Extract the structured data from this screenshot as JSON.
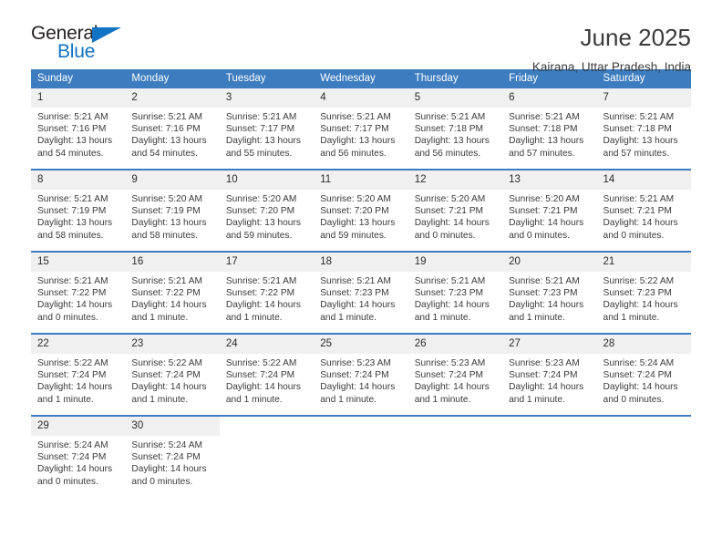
{
  "brand": {
    "name_part1": "General",
    "name_part2": "Blue",
    "accent_color": "#1272c4",
    "triangle_icon": "triangle-icon"
  },
  "header": {
    "title": "June 2025",
    "subtitle": "Kairana, Uttar Pradesh, India"
  },
  "colors": {
    "header_row": "#3c7cbf",
    "day_number_bg": "#f0f0f0",
    "text": "#3a3a3a"
  },
  "calendar": {
    "weekday_headers": [
      "Sunday",
      "Monday",
      "Tuesday",
      "Wednesday",
      "Thursday",
      "Friday",
      "Saturday"
    ],
    "weeks": [
      [
        {
          "day": "1",
          "sunrise": "Sunrise: 5:21 AM",
          "sunset": "Sunset: 7:16 PM",
          "daylight_line1": "Daylight: 13 hours",
          "daylight_line2": "and 54 minutes."
        },
        {
          "day": "2",
          "sunrise": "Sunrise: 5:21 AM",
          "sunset": "Sunset: 7:16 PM",
          "daylight_line1": "Daylight: 13 hours",
          "daylight_line2": "and 54 minutes."
        },
        {
          "day": "3",
          "sunrise": "Sunrise: 5:21 AM",
          "sunset": "Sunset: 7:17 PM",
          "daylight_line1": "Daylight: 13 hours",
          "daylight_line2": "and 55 minutes."
        },
        {
          "day": "4",
          "sunrise": "Sunrise: 5:21 AM",
          "sunset": "Sunset: 7:17 PM",
          "daylight_line1": "Daylight: 13 hours",
          "daylight_line2": "and 56 minutes."
        },
        {
          "day": "5",
          "sunrise": "Sunrise: 5:21 AM",
          "sunset": "Sunset: 7:18 PM",
          "daylight_line1": "Daylight: 13 hours",
          "daylight_line2": "and 56 minutes."
        },
        {
          "day": "6",
          "sunrise": "Sunrise: 5:21 AM",
          "sunset": "Sunset: 7:18 PM",
          "daylight_line1": "Daylight: 13 hours",
          "daylight_line2": "and 57 minutes."
        },
        {
          "day": "7",
          "sunrise": "Sunrise: 5:21 AM",
          "sunset": "Sunset: 7:18 PM",
          "daylight_line1": "Daylight: 13 hours",
          "daylight_line2": "and 57 minutes."
        }
      ],
      [
        {
          "day": "8",
          "sunrise": "Sunrise: 5:21 AM",
          "sunset": "Sunset: 7:19 PM",
          "daylight_line1": "Daylight: 13 hours",
          "daylight_line2": "and 58 minutes."
        },
        {
          "day": "9",
          "sunrise": "Sunrise: 5:20 AM",
          "sunset": "Sunset: 7:19 PM",
          "daylight_line1": "Daylight: 13 hours",
          "daylight_line2": "and 58 minutes."
        },
        {
          "day": "10",
          "sunrise": "Sunrise: 5:20 AM",
          "sunset": "Sunset: 7:20 PM",
          "daylight_line1": "Daylight: 13 hours",
          "daylight_line2": "and 59 minutes."
        },
        {
          "day": "11",
          "sunrise": "Sunrise: 5:20 AM",
          "sunset": "Sunset: 7:20 PM",
          "daylight_line1": "Daylight: 13 hours",
          "daylight_line2": "and 59 minutes."
        },
        {
          "day": "12",
          "sunrise": "Sunrise: 5:20 AM",
          "sunset": "Sunset: 7:21 PM",
          "daylight_line1": "Daylight: 14 hours",
          "daylight_line2": "and 0 minutes."
        },
        {
          "day": "13",
          "sunrise": "Sunrise: 5:20 AM",
          "sunset": "Sunset: 7:21 PM",
          "daylight_line1": "Daylight: 14 hours",
          "daylight_line2": "and 0 minutes."
        },
        {
          "day": "14",
          "sunrise": "Sunrise: 5:21 AM",
          "sunset": "Sunset: 7:21 PM",
          "daylight_line1": "Daylight: 14 hours",
          "daylight_line2": "and 0 minutes."
        }
      ],
      [
        {
          "day": "15",
          "sunrise": "Sunrise: 5:21 AM",
          "sunset": "Sunset: 7:22 PM",
          "daylight_line1": "Daylight: 14 hours",
          "daylight_line2": "and 0 minutes."
        },
        {
          "day": "16",
          "sunrise": "Sunrise: 5:21 AM",
          "sunset": "Sunset: 7:22 PM",
          "daylight_line1": "Daylight: 14 hours",
          "daylight_line2": "and 1 minute."
        },
        {
          "day": "17",
          "sunrise": "Sunrise: 5:21 AM",
          "sunset": "Sunset: 7:22 PM",
          "daylight_line1": "Daylight: 14 hours",
          "daylight_line2": "and 1 minute."
        },
        {
          "day": "18",
          "sunrise": "Sunrise: 5:21 AM",
          "sunset": "Sunset: 7:23 PM",
          "daylight_line1": "Daylight: 14 hours",
          "daylight_line2": "and 1 minute."
        },
        {
          "day": "19",
          "sunrise": "Sunrise: 5:21 AM",
          "sunset": "Sunset: 7:23 PM",
          "daylight_line1": "Daylight: 14 hours",
          "daylight_line2": "and 1 minute."
        },
        {
          "day": "20",
          "sunrise": "Sunrise: 5:21 AM",
          "sunset": "Sunset: 7:23 PM",
          "daylight_line1": "Daylight: 14 hours",
          "daylight_line2": "and 1 minute."
        },
        {
          "day": "21",
          "sunrise": "Sunrise: 5:22 AM",
          "sunset": "Sunset: 7:23 PM",
          "daylight_line1": "Daylight: 14 hours",
          "daylight_line2": "and 1 minute."
        }
      ],
      [
        {
          "day": "22",
          "sunrise": "Sunrise: 5:22 AM",
          "sunset": "Sunset: 7:24 PM",
          "daylight_line1": "Daylight: 14 hours",
          "daylight_line2": "and 1 minute."
        },
        {
          "day": "23",
          "sunrise": "Sunrise: 5:22 AM",
          "sunset": "Sunset: 7:24 PM",
          "daylight_line1": "Daylight: 14 hours",
          "daylight_line2": "and 1 minute."
        },
        {
          "day": "24",
          "sunrise": "Sunrise: 5:22 AM",
          "sunset": "Sunset: 7:24 PM",
          "daylight_line1": "Daylight: 14 hours",
          "daylight_line2": "and 1 minute."
        },
        {
          "day": "25",
          "sunrise": "Sunrise: 5:23 AM",
          "sunset": "Sunset: 7:24 PM",
          "daylight_line1": "Daylight: 14 hours",
          "daylight_line2": "and 1 minute."
        },
        {
          "day": "26",
          "sunrise": "Sunrise: 5:23 AM",
          "sunset": "Sunset: 7:24 PM",
          "daylight_line1": "Daylight: 14 hours",
          "daylight_line2": "and 1 minute."
        },
        {
          "day": "27",
          "sunrise": "Sunrise: 5:23 AM",
          "sunset": "Sunset: 7:24 PM",
          "daylight_line1": "Daylight: 14 hours",
          "daylight_line2": "and 1 minute."
        },
        {
          "day": "28",
          "sunrise": "Sunrise: 5:24 AM",
          "sunset": "Sunset: 7:24 PM",
          "daylight_line1": "Daylight: 14 hours",
          "daylight_line2": "and 0 minutes."
        }
      ],
      [
        {
          "day": "29",
          "sunrise": "Sunrise: 5:24 AM",
          "sunset": "Sunset: 7:24 PM",
          "daylight_line1": "Daylight: 14 hours",
          "daylight_line2": "and 0 minutes."
        },
        {
          "day": "30",
          "sunrise": "Sunrise: 5:24 AM",
          "sunset": "Sunset: 7:24 PM",
          "daylight_line1": "Daylight: 14 hours",
          "daylight_line2": "and 0 minutes."
        },
        {
          "day": "",
          "sunrise": "",
          "sunset": "",
          "daylight_line1": "",
          "daylight_line2": ""
        },
        {
          "day": "",
          "sunrise": "",
          "sunset": "",
          "daylight_line1": "",
          "daylight_line2": ""
        },
        {
          "day": "",
          "sunrise": "",
          "sunset": "",
          "daylight_line1": "",
          "daylight_line2": ""
        },
        {
          "day": "",
          "sunrise": "",
          "sunset": "",
          "daylight_line1": "",
          "daylight_line2": ""
        },
        {
          "day": "",
          "sunrise": "",
          "sunset": "",
          "daylight_line1": "",
          "daylight_line2": ""
        }
      ]
    ]
  }
}
